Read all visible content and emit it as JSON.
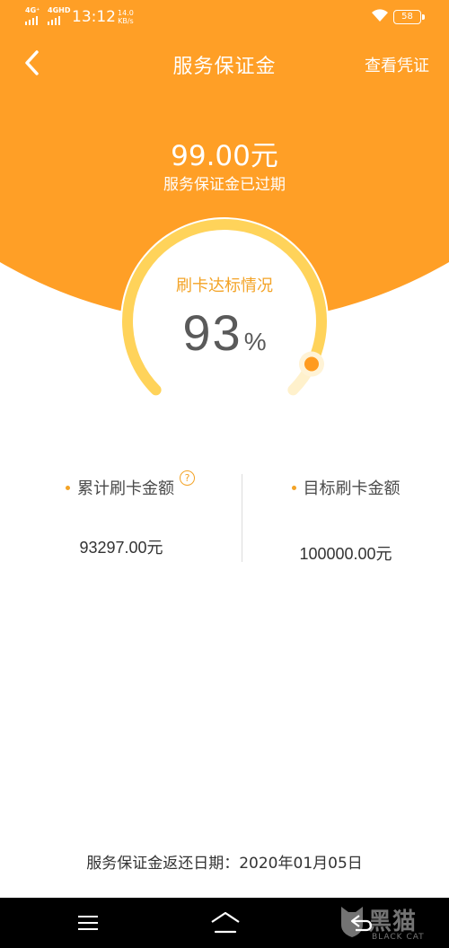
{
  "status_bar": {
    "sim1": "4G⁺",
    "sim2": "4GHD",
    "time": "13:12",
    "speed_value": "14.0",
    "speed_unit": "KB/s",
    "battery": "58"
  },
  "header": {
    "title": "服务保证金",
    "right_action": "查看凭证"
  },
  "deposit": {
    "amount": "99.00元",
    "status": "服务保证金已过期"
  },
  "gauge": {
    "title": "刷卡达标情况",
    "value": "93",
    "unit": "%",
    "progress_fraction": 0.93
  },
  "stats": {
    "accumulated_label": "累计刷卡金额",
    "help_symbol": "?",
    "accumulated_value": "93297.00元",
    "target_label": "目标刷卡金额",
    "target_value": "100000.00元"
  },
  "return_date": "服务保证金返还日期：2020年01月05日",
  "watermark": {
    "cn": "黑猫",
    "en": "BLACK CAT"
  },
  "colors": {
    "header_orange": "#ff9f26",
    "accent": "#f3a326",
    "track": "#ffd35a"
  },
  "icons": {
    "back": "chevron-left-icon",
    "menu": "menu-icon",
    "home": "home-icon",
    "nav_back": "back-icon"
  }
}
